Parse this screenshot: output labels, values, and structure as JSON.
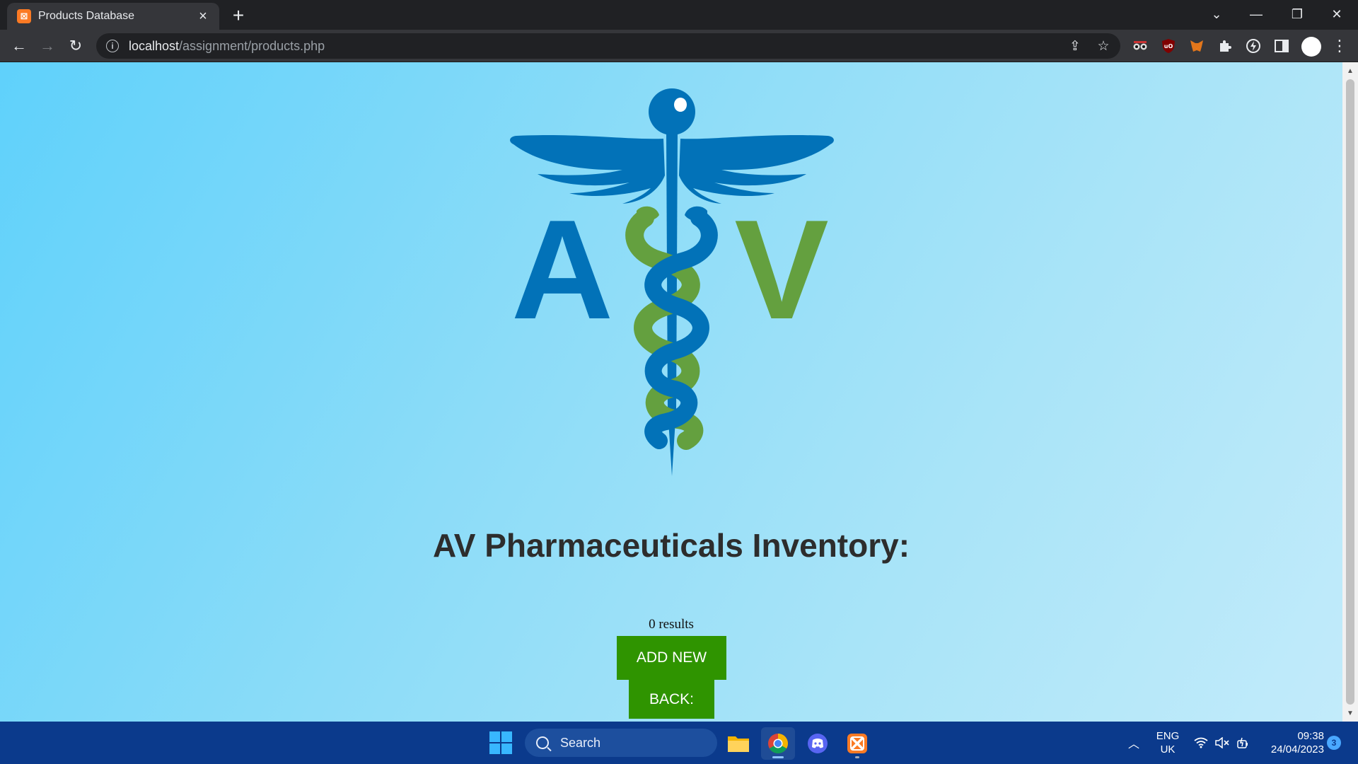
{
  "browser": {
    "tab": {
      "title": "Products Database",
      "favicon": "xampp-icon",
      "close_icon": "×"
    },
    "new_tab_icon": "+",
    "url": {
      "host": "localhost",
      "path": "/assignment/products.php"
    },
    "window_controls": {
      "tab_search": "⌄",
      "minimize": "—",
      "restore": "❐",
      "close": "✕"
    },
    "nav": {
      "back": "←",
      "forward": "→",
      "reload": "↻"
    },
    "omnibox_icons": {
      "share": "⇪",
      "bookmark": "☆"
    },
    "extensions": [
      "spy-glasses-icon",
      "ublock-icon",
      "metamask-icon",
      "puzzle-icon",
      "lightning-icon",
      "side-panel-icon"
    ],
    "menu_icon": "⋮"
  },
  "page": {
    "logo": {
      "letters": [
        "A",
        "V"
      ],
      "colors": {
        "blue": "#0272b8",
        "green": "#64a03f"
      }
    },
    "heading": "AV Pharmaceuticals Inventory:",
    "results_text": "0 results",
    "add_button": "ADD NEW",
    "back_button": "BACK:",
    "button_color": "#2f9400"
  },
  "taskbar": {
    "search_label": "Search",
    "apps": [
      "file-explorer-icon",
      "chrome-icon",
      "discord-icon",
      "xampp-icon"
    ],
    "language": {
      "line1": "ENG",
      "line2": "UK"
    },
    "clock": {
      "time": "09:38",
      "date": "24/04/2023"
    },
    "notification_count": "3"
  }
}
